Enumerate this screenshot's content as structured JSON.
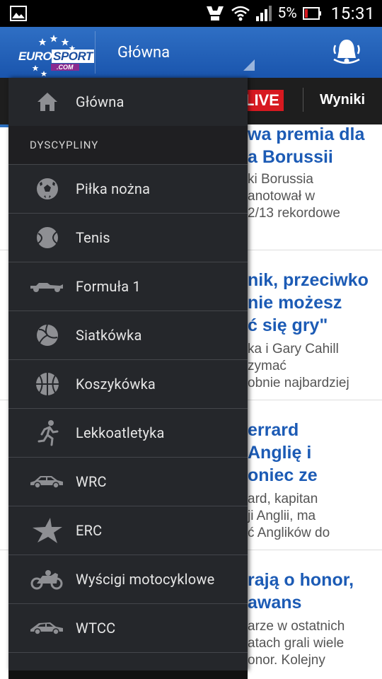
{
  "status_bar": {
    "battery": "5%",
    "time": "15:31"
  },
  "app_bar": {
    "logo_main": "EURO",
    "logo_sport": "SPORT",
    "logo_sub": ".COM",
    "title": "Główna"
  },
  "sub_bar": {
    "live": "LIVE",
    "results": "Wyniki"
  },
  "articles": [
    {
      "title_lines": [
        "wa premia dla",
        "a Borussii"
      ],
      "body_lines": [
        "ki Borussia",
        "anotował w",
        "2/13 rekordowe"
      ]
    },
    {
      "title_lines": [
        "nik, przeciwko",
        "nie możesz",
        "ć się gry\""
      ],
      "body_lines": [
        "ka i Gary Cahill",
        "zymać",
        "obnie najbardziej"
      ]
    },
    {
      "title_lines": [
        "errard",
        " Anglię i",
        "oniec ze"
      ],
      "body_lines": [
        "ard, kapitan",
        "ji Anglii, ma",
        "ć Anglików do"
      ]
    },
    {
      "title_lines": [
        "rają o honor,",
        " awans"
      ],
      "body_lines": [
        "arze w ostatnich",
        "atach grali wiele",
        "onor. Kolejny"
      ]
    }
  ],
  "drawer": {
    "home": {
      "label": "Główna",
      "icon": "home-icon"
    },
    "section_header": "DYSCYPLINY",
    "items": [
      {
        "label": "Piłka nożna",
        "icon": "soccer-ball-icon"
      },
      {
        "label": "Tenis",
        "icon": "tennis-ball-icon"
      },
      {
        "label": "Formuła 1",
        "icon": "formula-car-icon"
      },
      {
        "label": "Siatkówka",
        "icon": "volleyball-icon"
      },
      {
        "label": "Koszykówka",
        "icon": "basketball-icon"
      },
      {
        "label": "Lekkoatletyka",
        "icon": "runner-icon"
      },
      {
        "label": "WRC",
        "icon": "rally-car-icon"
      },
      {
        "label": "ERC",
        "icon": "star-icon"
      },
      {
        "label": "Wyścigi motocyklowe",
        "icon": "motorcycle-icon"
      },
      {
        "label": "WTCC",
        "icon": "touring-car-icon"
      }
    ]
  },
  "colors": {
    "app_bar": "#1a55ad",
    "drawer_bg": "#25272b",
    "live_red": "#d71920",
    "headline_blue": "#1c5bb5"
  }
}
